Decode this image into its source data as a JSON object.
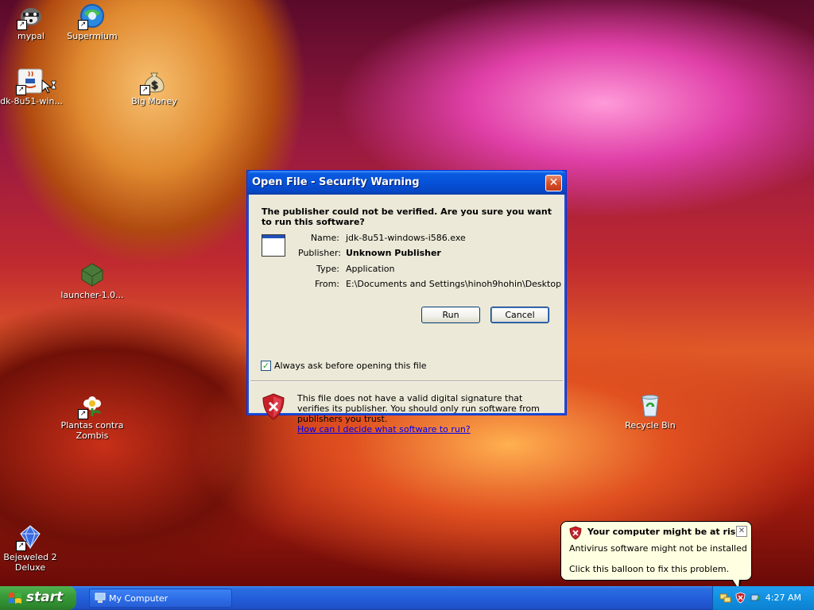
{
  "desktop": {
    "icons": [
      {
        "label": "mypal"
      },
      {
        "label": "Supermium"
      },
      {
        "label": "jdk-8u51-win..."
      },
      {
        "label": "Big Money"
      },
      {
        "label": "launcher-1.0..."
      },
      {
        "label": "Plantas contra Zombis"
      },
      {
        "label": "Bejeweled 2 Deluxe"
      },
      {
        "label": "Recycle Bin"
      }
    ]
  },
  "dialog": {
    "title": "Open File - Security Warning",
    "close_glyph": "✕",
    "question": "The publisher could not be verified.  Are you sure you want to run this software?",
    "fields": [
      {
        "label": "Name:",
        "value": "jdk-8u51-windows-i586.exe"
      },
      {
        "label": "Publisher:",
        "value": "Unknown Publisher"
      },
      {
        "label": "Type:",
        "value": "Application"
      },
      {
        "label": "From:",
        "value": "E:\\Documents and Settings\\hinoh9hohin\\Desktop"
      }
    ],
    "run_button": "Run",
    "cancel_button": "Cancel",
    "checkbox_label": "Always ask before opening this file",
    "checkbox_checked": true,
    "warning_text": "This file does not have a valid digital signature that verifies its publisher.  You should only run software from publishers you trust.",
    "help_link": "How can I decide what software to run?"
  },
  "taskbar": {
    "start_label": "start",
    "tasks": [
      {
        "label": "My Computer"
      }
    ],
    "clock": "4:27 AM"
  },
  "balloon": {
    "title": "Your computer might be at risk",
    "line1": "Antivirus software might not be installed",
    "line2": "Click this balloon to fix this problem.",
    "close_glyph": "✕"
  },
  "colors": {
    "titlebar_blue": "#0652d8",
    "dialog_bg": "#ece9d8",
    "start_green": "#3a9a3a",
    "tray_blue": "#1290e0",
    "balloon_bg": "#ffffe1",
    "shield_red": "#c8202a"
  }
}
